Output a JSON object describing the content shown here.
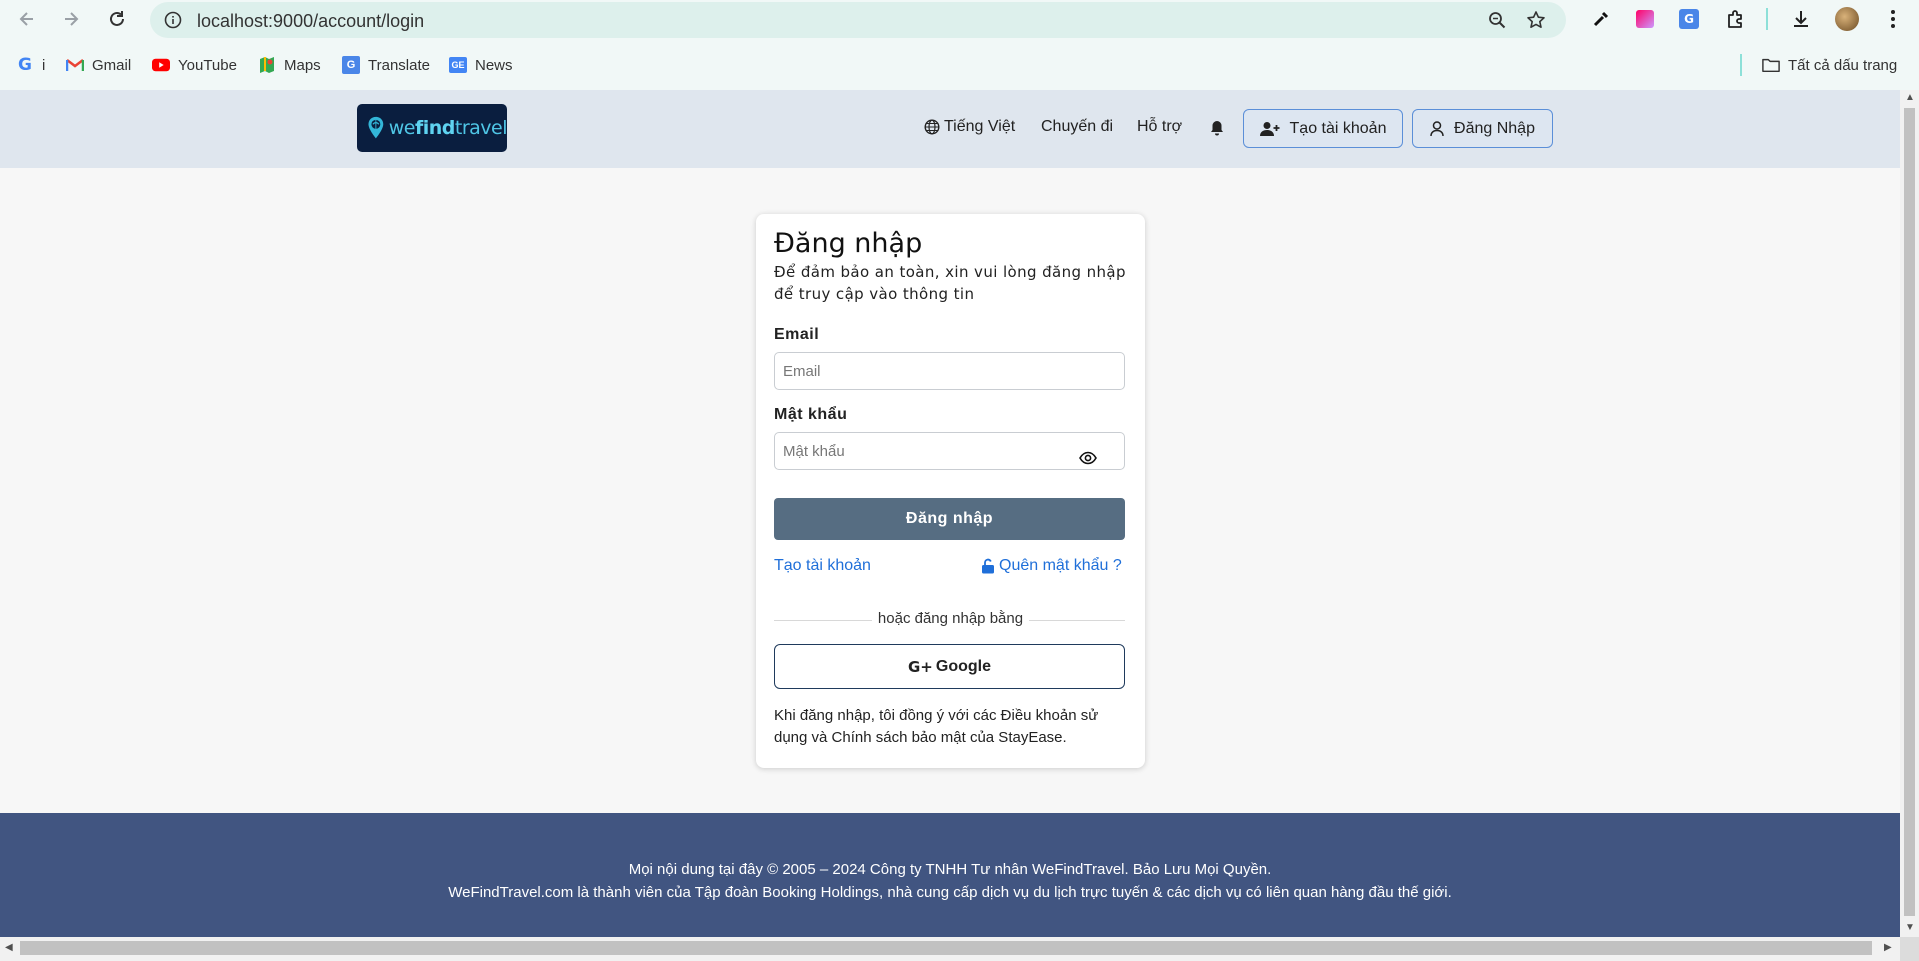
{
  "browser": {
    "url": "localhost:9000/account/login",
    "bookmarks": [
      {
        "label": "i",
        "icon": "google-icon"
      },
      {
        "label": "Gmail",
        "icon": "gmail-icon"
      },
      {
        "label": "YouTube",
        "icon": "youtube-icon"
      },
      {
        "label": "Maps",
        "icon": "maps-icon"
      },
      {
        "label": "Translate",
        "icon": "translate-icon"
      },
      {
        "label": "News",
        "icon": "news-icon"
      }
    ],
    "all_bookmarks": "Tất cả dấu trang"
  },
  "header": {
    "logo": {
      "we": "we",
      "find": "find",
      "travel": "travel"
    },
    "language": "Tiếng Việt",
    "trips": "Chuyến đi",
    "support": "Hỗ trợ",
    "create_account": "Tạo tài khoản",
    "login": "Đăng Nhập"
  },
  "login_form": {
    "title": "Đăng nhập",
    "subtitle": "Để đảm bảo an toàn, xin vui lòng đăng nhập để truy cập vào thông tin",
    "email_label": "Email",
    "email_placeholder": "Email",
    "password_label": "Mật khẩu",
    "password_placeholder": "Mật khẩu",
    "submit": "Đăng nhập",
    "create_account_link": "Tạo tài khoản",
    "forgot_password_link": "Quên mật khẩu ?",
    "divider_text": "hoặc đăng nhập bằng",
    "google_button": "Google",
    "terms": "Khi đăng nhập, tôi đồng ý với các Điều khoản sử dụng và Chính sách bảo mật của StayEase."
  },
  "footer": {
    "line1": "Mọi nội dung tại đây © 2005 – 2024 Công ty TNHH Tư nhân WeFindTravel. Bảo Lưu Mọi Quyền.",
    "line2": "WeFindTravel.com là thành viên của Tập đoàn Booking Holdings, nhà cung cấp dịch vụ du lịch trực tuyến & các dịch vụ có liên quan hàng đầu thế giới."
  },
  "colors": {
    "header_bg": "#dfe6ee",
    "footer_bg": "#415581",
    "submit_bg": "#566d82",
    "link": "#1f6fd9",
    "logo_bg": "#0a1e3f"
  }
}
